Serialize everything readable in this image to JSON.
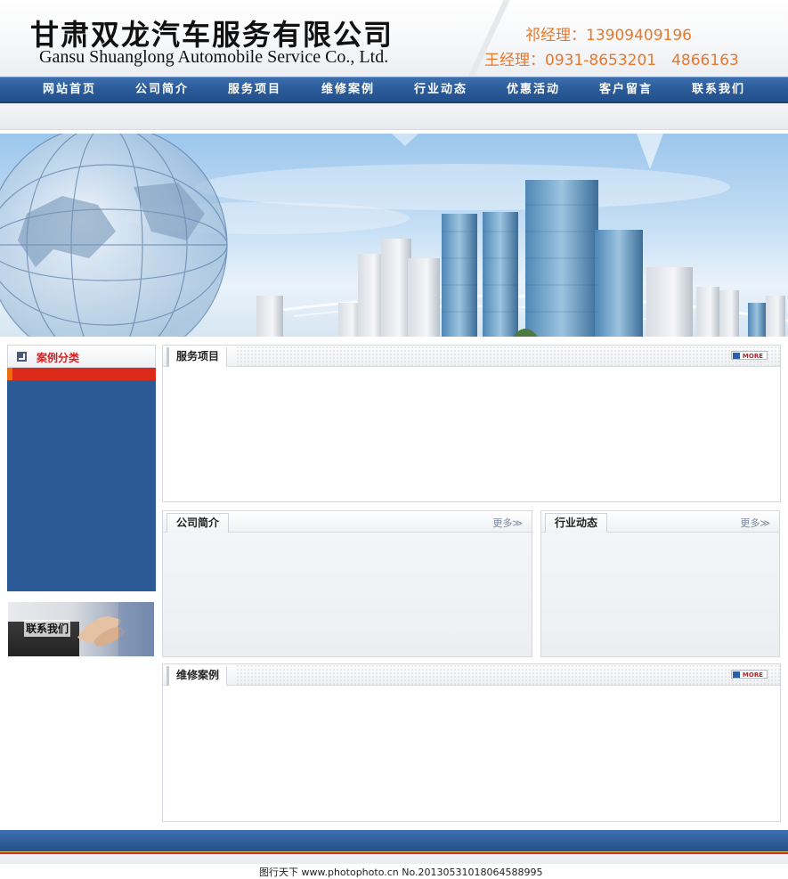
{
  "header": {
    "company_cn": "甘肃双龙汽车服务有限公司",
    "company_en": "Gansu Shuanglong Automobile Service Co., Ltd.",
    "contact_1": "祁经理：13909409196",
    "contact_2": "王经理：0931-8653201　4866163"
  },
  "nav": {
    "items": [
      {
        "label": "网站首页"
      },
      {
        "label": "公司简介"
      },
      {
        "label": "服务项目"
      },
      {
        "label": "维修案例"
      },
      {
        "label": "行业动态"
      },
      {
        "label": "优惠活动"
      },
      {
        "label": "客户留言"
      },
      {
        "label": "联系我们"
      }
    ]
  },
  "sidebar": {
    "category_title": "案例分类",
    "contact_banner_label": "联系我们"
  },
  "panels": {
    "services": {
      "title": "服务项目",
      "more": "MORE"
    },
    "about": {
      "title": "公司简介",
      "more": "更多≫"
    },
    "news": {
      "title": "行业动态",
      "more": "更多≫"
    },
    "cases": {
      "title": "维修案例",
      "more": "MORE"
    }
  },
  "watermark": "图行天下 www.photophoto.cn No.20130531018064588995",
  "colors": {
    "nav_blue": "#2a5a98",
    "accent_orange": "#e8782a",
    "accent_red": "#d42020",
    "sidebar_blue": "#2c5a96"
  }
}
